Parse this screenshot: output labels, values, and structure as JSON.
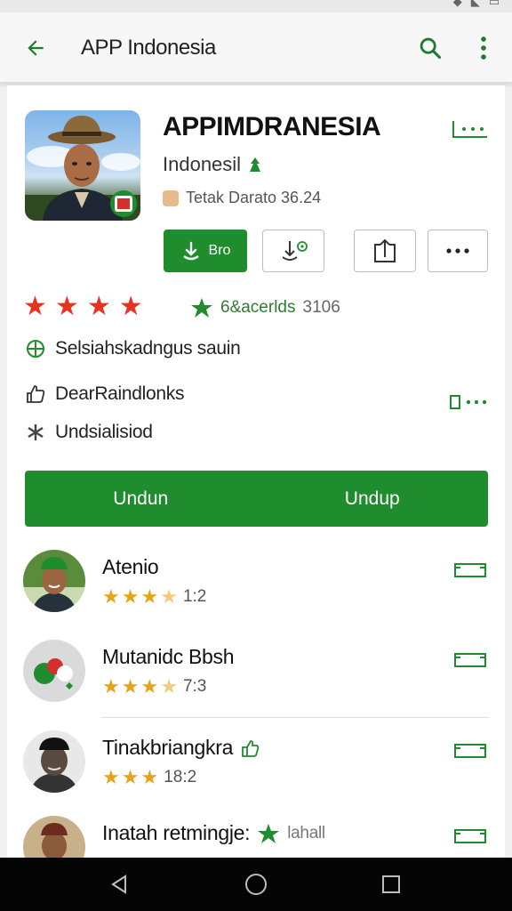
{
  "app_bar": {
    "title": "APP Indonesia"
  },
  "app": {
    "name": "APPIMDRANESIA",
    "developer": "Indonesil",
    "meta": "Tetak Darato 36.24",
    "install_label": "Bro"
  },
  "rating": {
    "stars": 4,
    "reviews_label": "6&acerlds",
    "reviews_count": "3106"
  },
  "info": {
    "line1": "Selsiahskadngus sauin",
    "line2": "DearRaindlonks",
    "line3": "Undsialisiod"
  },
  "download_bar": {
    "left_label": "Undun",
    "right_label": "Undup"
  },
  "reviews": [
    {
      "name": "Atenio",
      "stars": 3.5,
      "score": "1:2"
    },
    {
      "name": "Mutanidc Bbsh",
      "stars": 3.5,
      "score": "7:3"
    },
    {
      "name": "Tinakbriangkra",
      "stars": 3,
      "score": "18:2"
    },
    {
      "name": "Inatah retmingje:",
      "tag": "lahall"
    }
  ],
  "colors": {
    "accent_green": "#1f8c2e",
    "star_red": "#e53522",
    "star_gold": "#e7a417"
  }
}
